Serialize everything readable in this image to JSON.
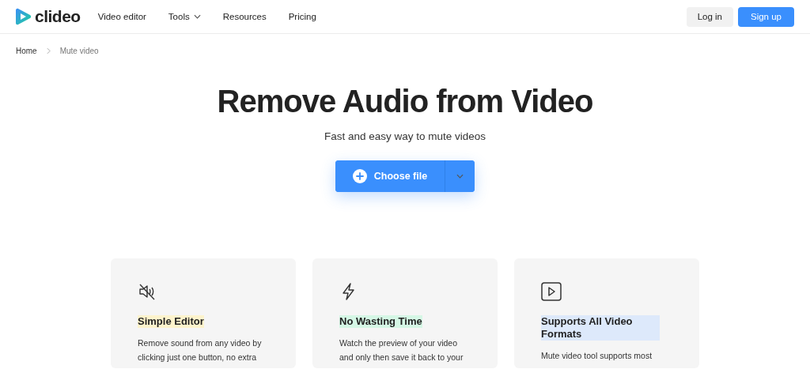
{
  "header": {
    "logo": "clideo",
    "nav": [
      {
        "label": "Video editor",
        "dropdown": false
      },
      {
        "label": "Tools",
        "dropdown": true
      },
      {
        "label": "Resources",
        "dropdown": false
      },
      {
        "label": "Pricing",
        "dropdown": false
      }
    ],
    "buttons": [
      {
        "label": "Log in",
        "kind": "secondary"
      },
      {
        "label": "Sign up",
        "kind": "primary"
      }
    ]
  },
  "breadcrumb": [
    {
      "label": "Home"
    },
    {
      "label": "Mute video"
    }
  ],
  "hero": {
    "title": "Remove Audio from Video",
    "subtitle": "Fast and easy way to mute videos",
    "button": "Choose file"
  },
  "features": [
    {
      "kind": "mute",
      "title": "Simple Editor",
      "color": "#fdf3cc",
      "text": "Remove sound from any video by clicking just one button, no extra"
    },
    {
      "kind": "bolt",
      "title": "No Wasting Time",
      "color": "#d5f7e5",
      "text": "Watch the preview of your video and only then save it back to your"
    },
    {
      "kind": "play",
      "title": "Supports All Video Formats",
      "color": "#dde9fb",
      "text": "Mute video tool supports most"
    }
  ]
}
